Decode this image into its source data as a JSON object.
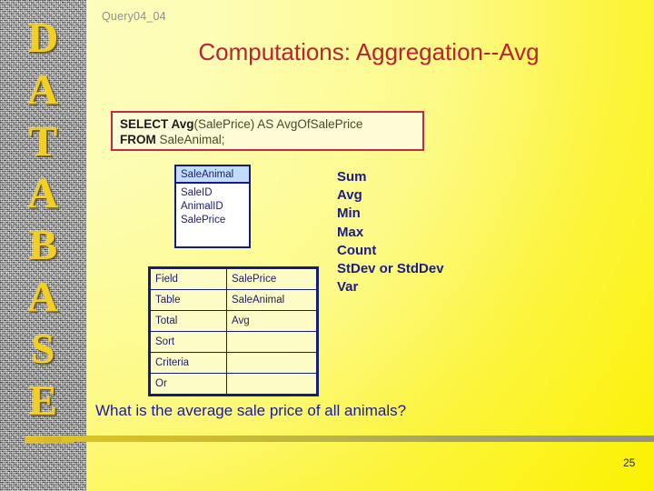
{
  "slide": {
    "header_label": "Query04_04",
    "title": "Computations:  Aggregation--Avg",
    "question": "What is the average sale price of all animals?",
    "page_number": "25"
  },
  "sidebar": {
    "letters": [
      "D",
      "A",
      "T",
      "A",
      "B",
      "A",
      "S",
      "E"
    ],
    "word": "DATABASE"
  },
  "sql": {
    "line1_keyword": "SELECT Avg",
    "line1_rest": "(SalePrice) AS AvgOfSalePrice",
    "line2_keyword": "FROM",
    "line2_rest": " SaleAnimal;"
  },
  "table_box": {
    "name": "SaleAnimal",
    "fields": [
      "SaleID",
      "AnimalID",
      "SalePrice"
    ]
  },
  "qbe": {
    "rows": [
      {
        "label": "Field",
        "value": "SalePrice"
      },
      {
        "label": "Table",
        "value": "SaleAnimal"
      },
      {
        "label": "Total",
        "value": "Avg"
      },
      {
        "label": "Sort",
        "value": ""
      },
      {
        "label": "Criteria",
        "value": ""
      },
      {
        "label": "Or",
        "value": ""
      }
    ]
  },
  "aggregates": {
    "items": [
      "Sum",
      "Avg",
      "Min",
      "Max",
      "Count",
      "StDev or StdDev",
      "Var"
    ]
  },
  "colors": {
    "background_pale": "#fdfdbe",
    "background_bright": "#fbf200",
    "title_red": "#bb2233",
    "sql_border": "#c32a47",
    "grid_blue": "#131c80",
    "text_blue": "#1b1b8e",
    "sidebar_letter_gold": "#f2cf22",
    "header_gray": "#8a8f9a"
  }
}
